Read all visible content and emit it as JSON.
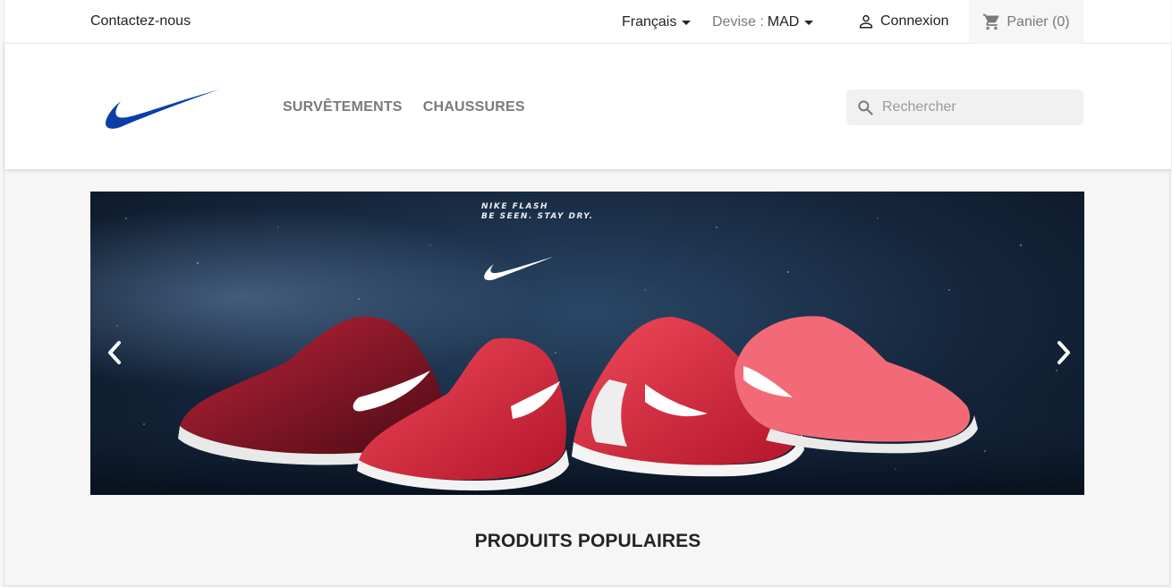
{
  "top_nav": {
    "contact_label": "Contactez-nous",
    "language_label": "Français",
    "currency_prefix": "Devise :",
    "currency_value": "MAD",
    "login_label": "Connexion",
    "cart_label": "Panier (0)"
  },
  "header": {
    "logo_icon": "nike-swoosh-icon",
    "menu": [
      "SURVÊTEMENTS",
      "CHAUSSURES"
    ],
    "search_placeholder": "Rechercher"
  },
  "carousel": {
    "tagline_line1": "NIKE FLASH",
    "tagline_line2": "BE SEEN. STAY DRY."
  },
  "sections": {
    "popular_title": "PRODUITS POPULAIRES"
  },
  "colors": {
    "brand_blue": "#0b3ea8",
    "shoe_red": "#d8283a"
  }
}
